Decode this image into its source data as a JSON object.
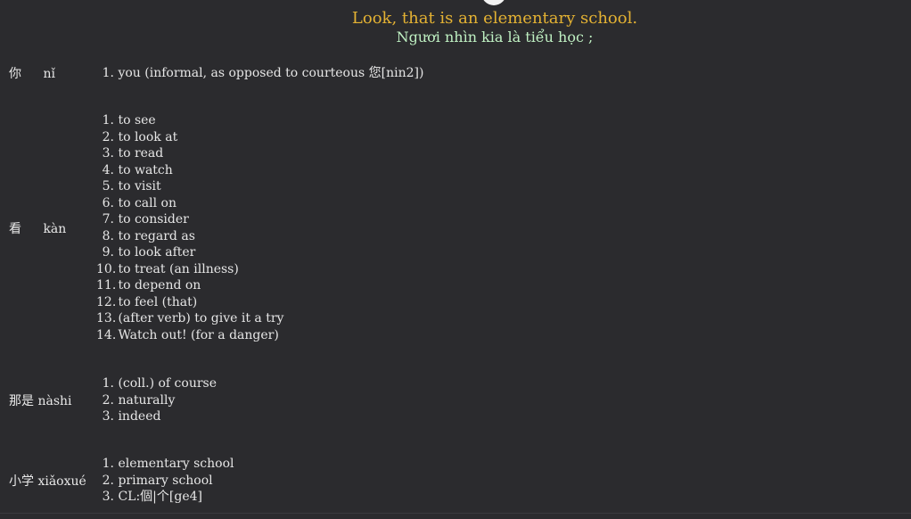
{
  "header": {
    "sentence_en": "Look, that is an elementary school.",
    "sentence_vi": "Ngươi nhìn kia là tiểu học ;",
    "colors": {
      "english": "#e4b233",
      "vietnamese": "#bff0c2",
      "background": "#2b2b2e"
    }
  },
  "entries": [
    {
      "hanzi": "你",
      "pinyin": "nǐ",
      "definitions": [
        "you (informal, as opposed to courteous 您[nin2])"
      ]
    },
    {
      "hanzi": "看",
      "pinyin": "kàn",
      "definitions": [
        "to see",
        "to look at",
        "to read",
        "to watch",
        "to visit",
        "to call on",
        "to consider",
        "to regard as",
        "to look after",
        "to treat (an illness)",
        "to depend on",
        "to feel (that)",
        "(after verb) to give it a try",
        "Watch out! (for a danger)"
      ]
    },
    {
      "hanzi": "那是",
      "pinyin": "nàshi",
      "definitions": [
        "(coll.) of course",
        "naturally",
        "indeed"
      ]
    },
    {
      "hanzi": "小学",
      "pinyin": "xiǎoxué",
      "definitions": [
        "elementary school",
        "primary school",
        "CL:個|个[ge4]"
      ]
    }
  ]
}
